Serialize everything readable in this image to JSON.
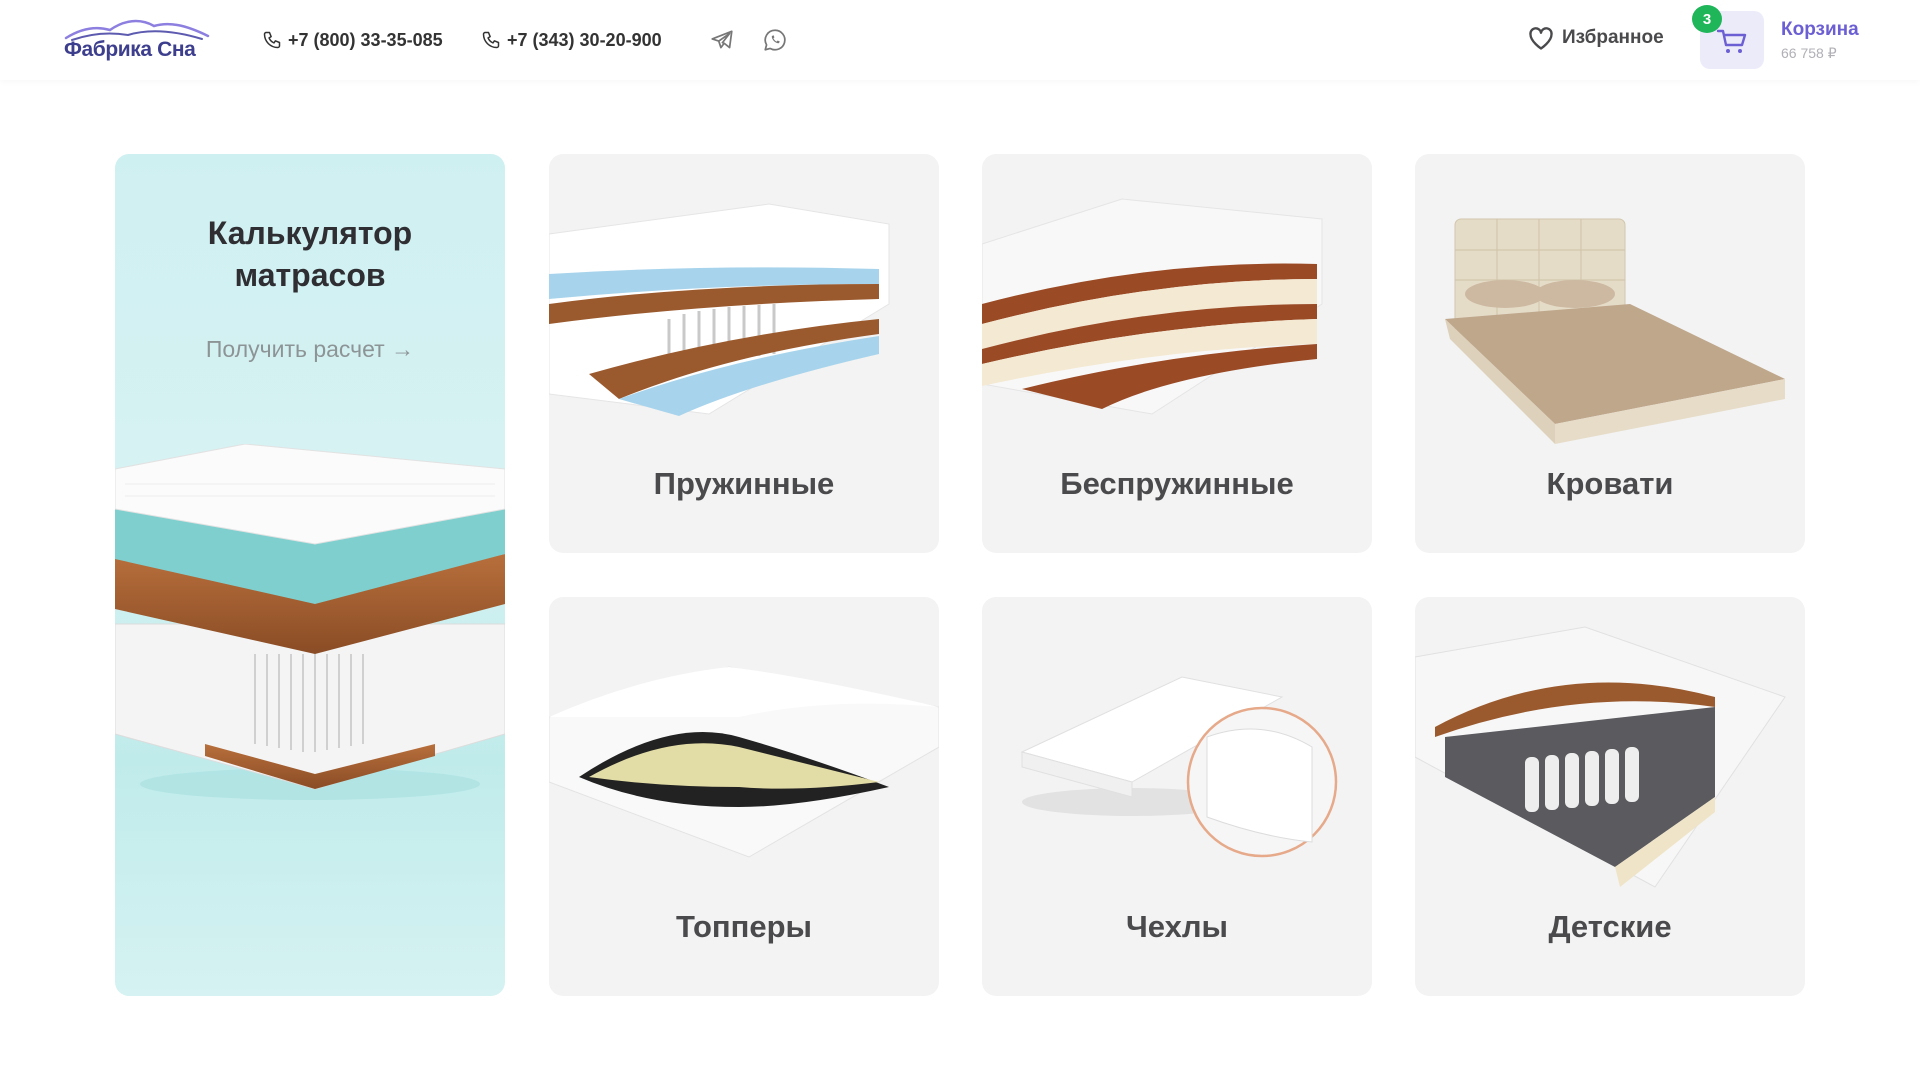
{
  "header": {
    "logo_text": "Фабрика Сна",
    "phones": [
      "+7 (800) 33-35-085",
      "+7 (343) 30-20-900"
    ],
    "socials": [
      "telegram-icon",
      "whatsapp-icon"
    ],
    "favorites_label": "Избранное",
    "cart": {
      "label": "Корзина",
      "count": "3",
      "total": "66 758 ₽"
    }
  },
  "calculator": {
    "title_line1": "Калькулятор",
    "title_line2": "матрасов",
    "link": "Получить расчет →"
  },
  "categories": [
    {
      "label": "Пружинные",
      "image": "spring-mattress-cutaway"
    },
    {
      "label": "Беспружинные",
      "image": "springless-mattress-cutaway"
    },
    {
      "label": "Кровати",
      "image": "bed"
    },
    {
      "label": "Топперы",
      "image": "topper"
    },
    {
      "label": "Чехлы",
      "image": "mattress-cover"
    },
    {
      "label": "Детские",
      "image": "kids-mattress"
    }
  ],
  "colors": {
    "brand": "#3d3f8e",
    "accent": "#6b5fd3",
    "badge": "#1fb65a",
    "calc_bg": "#cff0f1",
    "card_bg": "#f3f3f3"
  }
}
